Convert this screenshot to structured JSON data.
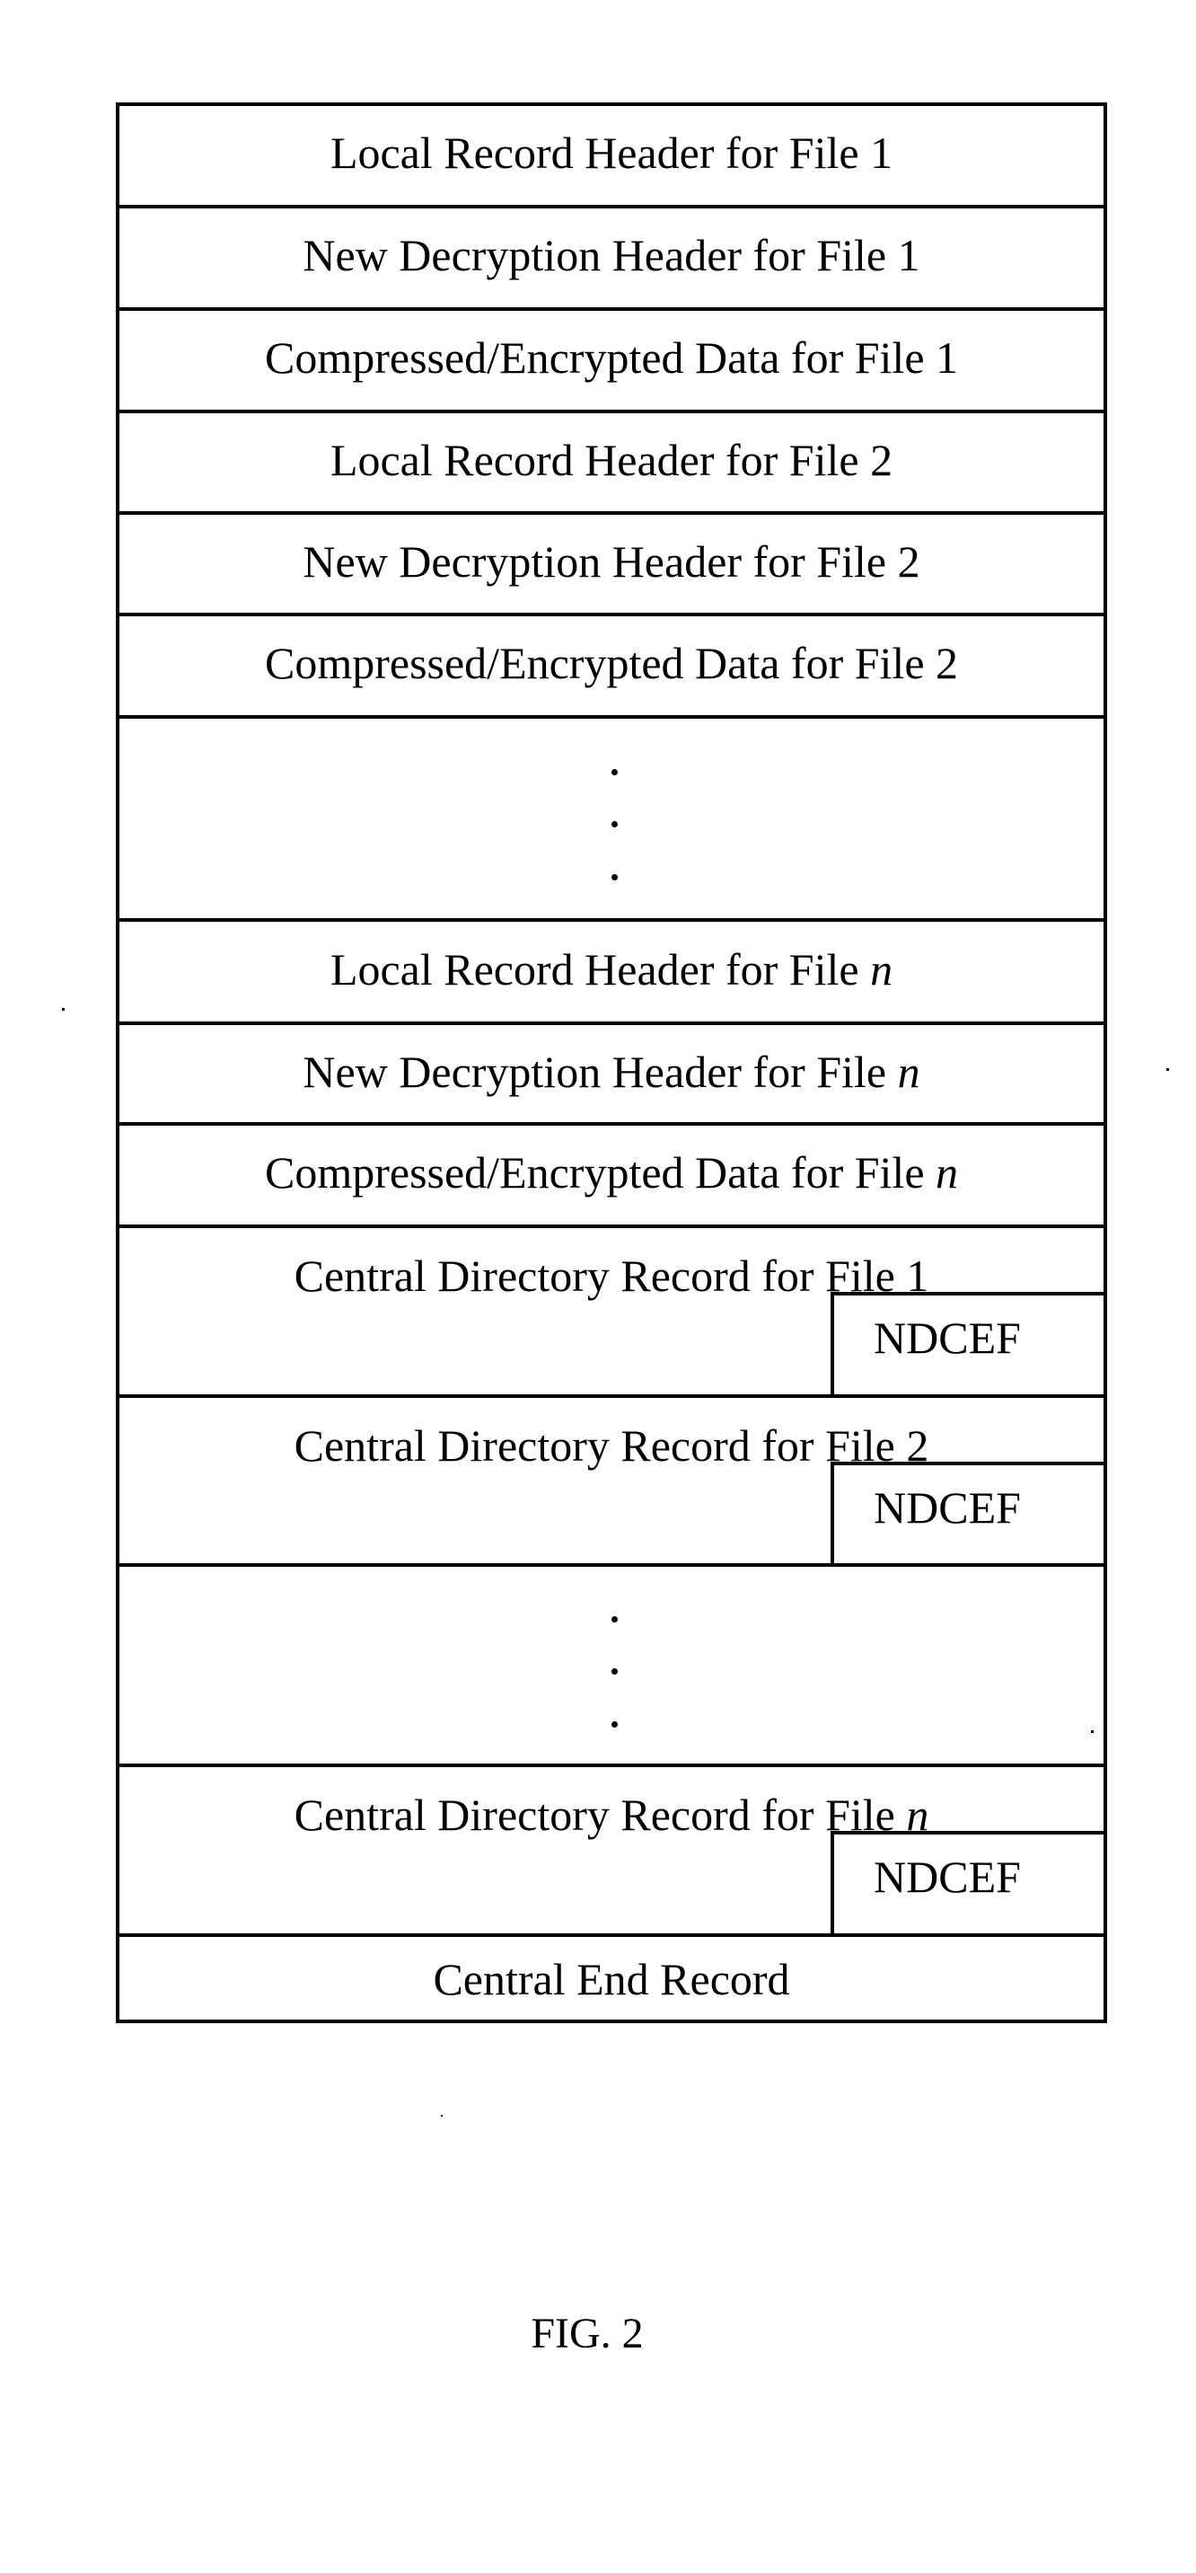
{
  "figure": {
    "caption": "FIG. 2",
    "colors": {
      "line": "#000000",
      "background": "#ffffff"
    }
  },
  "rows": [
    {
      "type": "record",
      "text": "Local Record Header for File ",
      "suffix": "1",
      "suffix_italic": false
    },
    {
      "type": "record",
      "text": "New Decryption Header for File ",
      "suffix": "1",
      "suffix_italic": false
    },
    {
      "type": "record",
      "text": "Compressed/Encrypted Data for File ",
      "suffix": "1",
      "suffix_italic": false
    },
    {
      "type": "record",
      "text": "Local Record Header for File ",
      "suffix": "2",
      "suffix_italic": false
    },
    {
      "type": "record",
      "text": "New Decryption Header for File ",
      "suffix": "2",
      "suffix_italic": false
    },
    {
      "type": "record",
      "text": "Compressed/Encrypted Data for File ",
      "suffix": "2",
      "suffix_italic": false
    },
    {
      "type": "ellipsis",
      "dots": [
        "·",
        "·",
        "·"
      ]
    },
    {
      "type": "record",
      "text": "Local Record Header for File ",
      "suffix": "n",
      "suffix_italic": true
    },
    {
      "type": "record",
      "text": "New Decryption Header for File ",
      "suffix": "n",
      "suffix_italic": true
    },
    {
      "type": "record",
      "text": "Compressed/Encrypted Data for File ",
      "suffix": "n",
      "suffix_italic": true
    },
    {
      "type": "directory",
      "text": "Central Directory Record for File ",
      "suffix": "1",
      "suffix_italic": false,
      "field": "NDCEF"
    },
    {
      "type": "directory",
      "text": "Central Directory Record for File ",
      "suffix": "2",
      "suffix_italic": false,
      "field": "NDCEF"
    },
    {
      "type": "ellipsis",
      "dots": [
        "·",
        "·",
        "·"
      ]
    },
    {
      "type": "directory",
      "text": "Central Directory Record for File ",
      "suffix": "n",
      "suffix_italic": true,
      "field": "NDCEF"
    },
    {
      "type": "end",
      "text": "Central End Record",
      "suffix": "",
      "suffix_italic": false
    }
  ]
}
